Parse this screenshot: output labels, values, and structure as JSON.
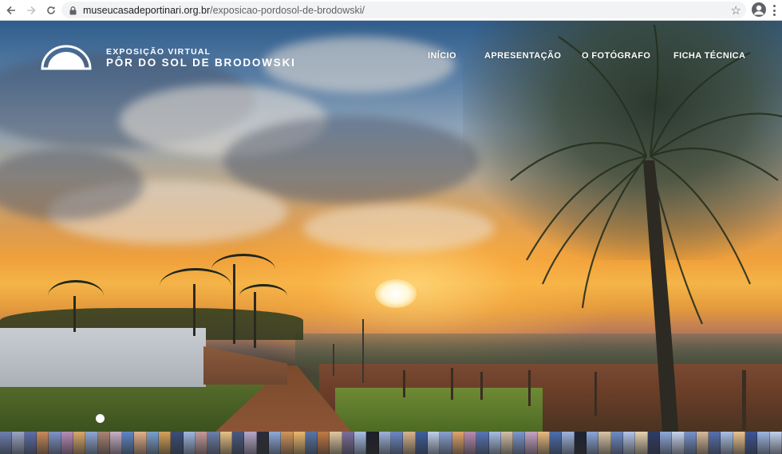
{
  "browser": {
    "url_domain": "museucasadeportinari.org.br",
    "url_path": "/exposicao-pordosol-de-brodowski/",
    "back_icon": "arrow-left-icon",
    "forward_icon": "arrow-right-icon",
    "reload_icon": "reload-icon",
    "bookmark_icon": "star-icon"
  },
  "site": {
    "logo_icon": "half-sun-arch-logo",
    "subtitle": "EXPOSIÇÃO VIRTUAL",
    "title": "PÔR DO SOL DE BRODOWSKI",
    "nav": [
      "INÍCIO",
      "APRESENTAÇÃO",
      "O FOTÓGRAFO",
      "FICHA TÉCNICA"
    ]
  },
  "colors": {
    "header_text": "#ffffff",
    "chrome_bg": "#ffffff",
    "omnibox_bg": "#f1f3f4"
  },
  "thumbnails": [
    "#6d7fb0",
    "#9aa5c4",
    "#5d6ea8",
    "#c98a5a",
    "#7f93c8",
    "#b88cb8",
    "#d9a86a",
    "#8ea6d4",
    "#a98472",
    "#c7b0c6",
    "#5f86c4",
    "#e3b08a",
    "#7aa0cf",
    "#d6a25a",
    "#3c4f7a",
    "#9fb7df",
    "#c49a9a",
    "#6e7fa8",
    "#e9c184",
    "#4a5a80",
    "#b5a8c9",
    "#2a2d3a",
    "#8fa9d8",
    "#d2955a",
    "#eab86e",
    "#5a74a6",
    "#c27a44",
    "#e0c8a0",
    "#7d6e9a",
    "#a9bfe6",
    "#1c1f28",
    "#9db2da",
    "#6c88c2",
    "#d7b48c",
    "#3e5f9c",
    "#c0cfea",
    "#88a2d2",
    "#e2a46a",
    "#b58cb0",
    "#5777b5",
    "#a8bde3",
    "#d2c0a8",
    "#7b98ce",
    "#c7a3c3",
    "#e8ba80",
    "#4c6dae",
    "#9eb3dc",
    "#1e2230",
    "#8aa6d8",
    "#d9c4a6",
    "#6f8cc6",
    "#b4c4e6",
    "#e6d2b0",
    "#2f3d66",
    "#8ea9da",
    "#c6d3ee",
    "#7592cc",
    "#d8b998",
    "#5671b0",
    "#aabfe5",
    "#eac290",
    "#3d5597",
    "#9db5e0",
    "#c3d1ec"
  ]
}
